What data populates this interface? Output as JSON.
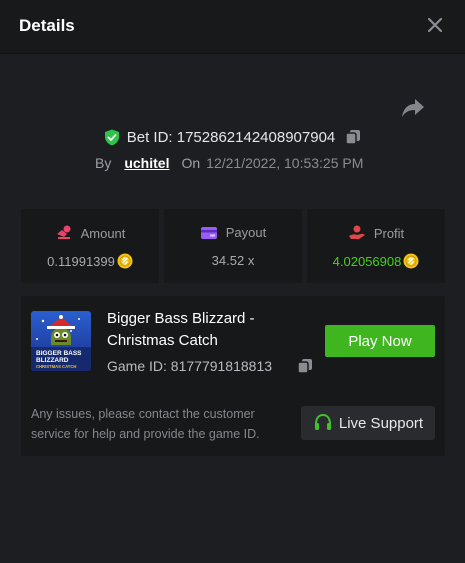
{
  "header": {
    "title": "Details",
    "close_icon": "close-icon"
  },
  "share_icon": "share-icon",
  "bet": {
    "id_label": "Bet ID: 1752862142408907904",
    "by_label": "By",
    "user": "uchitel",
    "on_label": "On",
    "datetime": "12/21/2022, 10:53:25 PM"
  },
  "stats": {
    "amount": {
      "label": "Amount",
      "value": "0.11991399",
      "icon": "money-hand-icon"
    },
    "payout": {
      "label": "Payout",
      "value": "34.52 x",
      "icon": "wallet-card-icon"
    },
    "profit": {
      "label": "Profit",
      "value": "4.02056908",
      "icon": "profit-hand-icon"
    }
  },
  "game": {
    "title": "Bigger Bass Blizzard - Christmas Catch",
    "id_label": "Game ID: 8177791818813",
    "thumbnail_lines": [
      "BIGGER BASS",
      "BLIZZARD",
      "CHRISTMAS CATCH"
    ],
    "play_label": "Play Now",
    "issue_text": "Any issues, please contact the customer service for help and provide the game ID.",
    "support_label": "Live Support"
  },
  "colors": {
    "accent_green": "#3fb61f",
    "profit_green": "#44d21a",
    "amount_icon": "#e8446a",
    "payout_icon": "#9b5cf6",
    "profit_icon": "#e2454a",
    "coin": "#f5c518"
  }
}
